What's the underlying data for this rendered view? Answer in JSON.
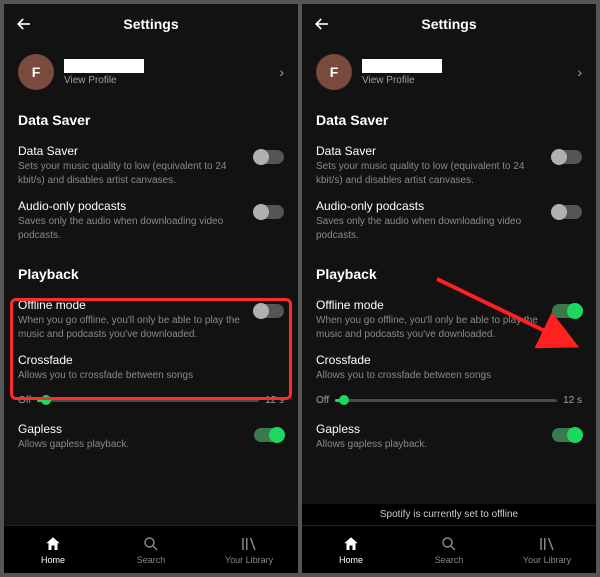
{
  "header": {
    "title": "Settings"
  },
  "profile": {
    "initial": "F",
    "view_profile": "View Profile"
  },
  "sections": {
    "data_saver": {
      "heading": "Data Saver",
      "data_saver": {
        "title": "Data Saver",
        "desc": "Sets your music quality to low (equivalent to 24 kbit/s) and disables artist canvases."
      },
      "audio_only": {
        "title": "Audio-only podcasts",
        "desc": "Saves only the audio when downloading video podcasts."
      }
    },
    "playback": {
      "heading": "Playback",
      "offline": {
        "title": "Offline mode",
        "desc": "When you go offline, you'll only be able to play the music and podcasts you've downloaded."
      },
      "crossfade": {
        "title": "Crossfade",
        "desc": "Allows you to crossfade between songs",
        "min": "Off",
        "max": "12 s"
      },
      "gapless": {
        "title": "Gapless",
        "desc": "Allows gapless playback."
      }
    }
  },
  "nav": {
    "home": "Home",
    "search": "Search",
    "library": "Your Library"
  },
  "toast": "Spotify is currently set to offline"
}
